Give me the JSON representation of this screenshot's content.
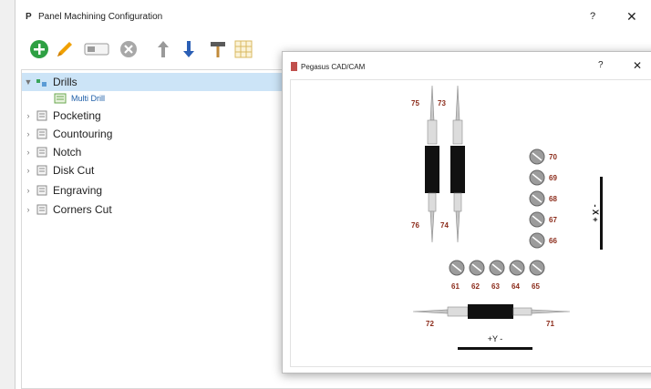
{
  "window": {
    "title": "Panel Machining Configuration",
    "icon_label": "P",
    "help_glyph": "?",
    "close_glyph": "✕"
  },
  "toolbar": {
    "items": [
      {
        "name": "add-icon",
        "color": "#2ea043"
      },
      {
        "name": "pencil-icon",
        "color": "#f0a000"
      },
      {
        "name": "toggle-icon",
        "color": "#9a9a9a"
      },
      {
        "name": "delete-icon",
        "color": "#a0a0a0"
      },
      {
        "name": "arrow-up-icon",
        "color": "#9a9a9a"
      },
      {
        "name": "arrow-down-icon",
        "color": "#2b5fb5"
      },
      {
        "name": "hammer-icon",
        "color": "#6b6b6b"
      },
      {
        "name": "grid-icon",
        "color": "#d8b860"
      }
    ]
  },
  "tree": {
    "items": [
      {
        "label": "Drills",
        "expanded": true,
        "selected": true
      },
      {
        "label": "Multi Drill",
        "child": true
      },
      {
        "label": "Pocketing"
      },
      {
        "label": "Countouring"
      },
      {
        "label": "Notch"
      },
      {
        "label": "Disk Cut"
      },
      {
        "label": "Engraving"
      },
      {
        "label": "Corners Cut"
      }
    ]
  },
  "dialog": {
    "title": "Pegasus CAD/CAM",
    "help_glyph": "?",
    "close_glyph": "✕",
    "accent": "#c0504d",
    "vertical_tools": [
      {
        "top_label": "75",
        "bottom_label": "76"
      },
      {
        "top_label": "73",
        "bottom_label": "74"
      }
    ],
    "right_column": [
      "70",
      "69",
      "68",
      "67",
      "66"
    ],
    "bottom_row": [
      "61",
      "62",
      "63",
      "64",
      "65"
    ],
    "horizontal_tool": {
      "left_label": "72",
      "right_label": "71"
    },
    "x_axis_label": "- X +",
    "y_axis_label": "+Y -",
    "label_color": "#8b2b1a"
  }
}
